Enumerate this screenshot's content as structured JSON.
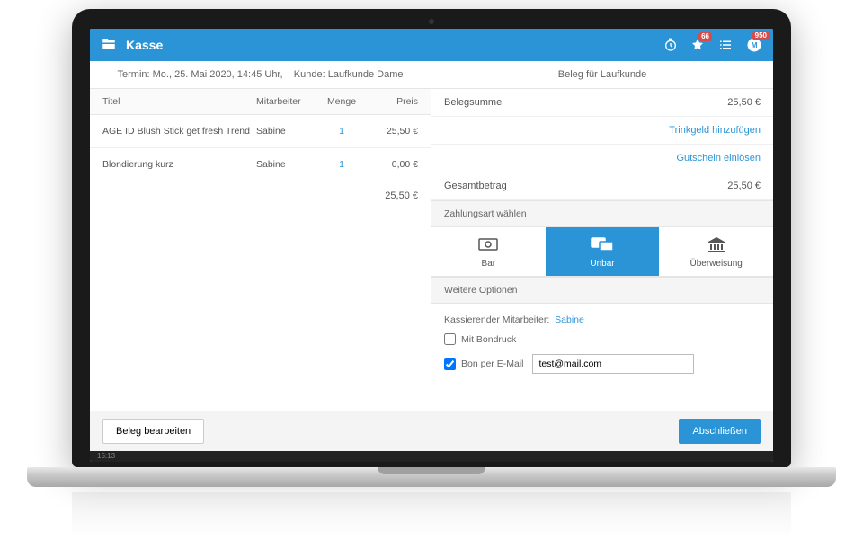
{
  "header": {
    "title": "Kasse",
    "badge_notifications": "66",
    "badge_user": "950"
  },
  "left": {
    "appointment_prefix": "Termin:",
    "appointment_time": "Mo., 25. Mai 2020, 14:45 Uhr,",
    "customer_prefix": "Kunde:",
    "customer_name": "Laufkunde Dame",
    "columns": {
      "title": "Titel",
      "employee": "Mitarbeiter",
      "qty": "Menge",
      "price": "Preis"
    },
    "items": [
      {
        "title": "AGE ID Blush Stick get fresh Trend",
        "employee": "Sabine",
        "qty": "1",
        "price": "25,50 €"
      },
      {
        "title": "Blondierung kurz",
        "employee": "Sabine",
        "qty": "1",
        "price": "0,00 €"
      }
    ],
    "total": "25,50 €"
  },
  "right": {
    "header": "Beleg für Laufkunde",
    "subtotal_label": "Belegsumme",
    "subtotal_value": "25,50 €",
    "tip_link": "Trinkgeld hinzufügen",
    "voucher_link": "Gutschein einlösen",
    "total_label": "Gesamtbetrag",
    "total_value": "25,50 €",
    "payment_label": "Zahlungsart wählen",
    "payment_options": {
      "cash": "Bar",
      "noncash": "Unbar",
      "transfer": "Überweisung"
    },
    "more_options_label": "Weitere Optionen",
    "cashier_label": "Kassierender Mitarbeiter:",
    "cashier_name": "Sabine",
    "print_label": "Mit Bondruck",
    "email_label": "Bon per E-Mail",
    "email_value": "test@mail.com"
  },
  "footer": {
    "edit_btn": "Beleg bearbeiten",
    "finish_btn": "Abschließen"
  },
  "taskbar_time": "15:13"
}
